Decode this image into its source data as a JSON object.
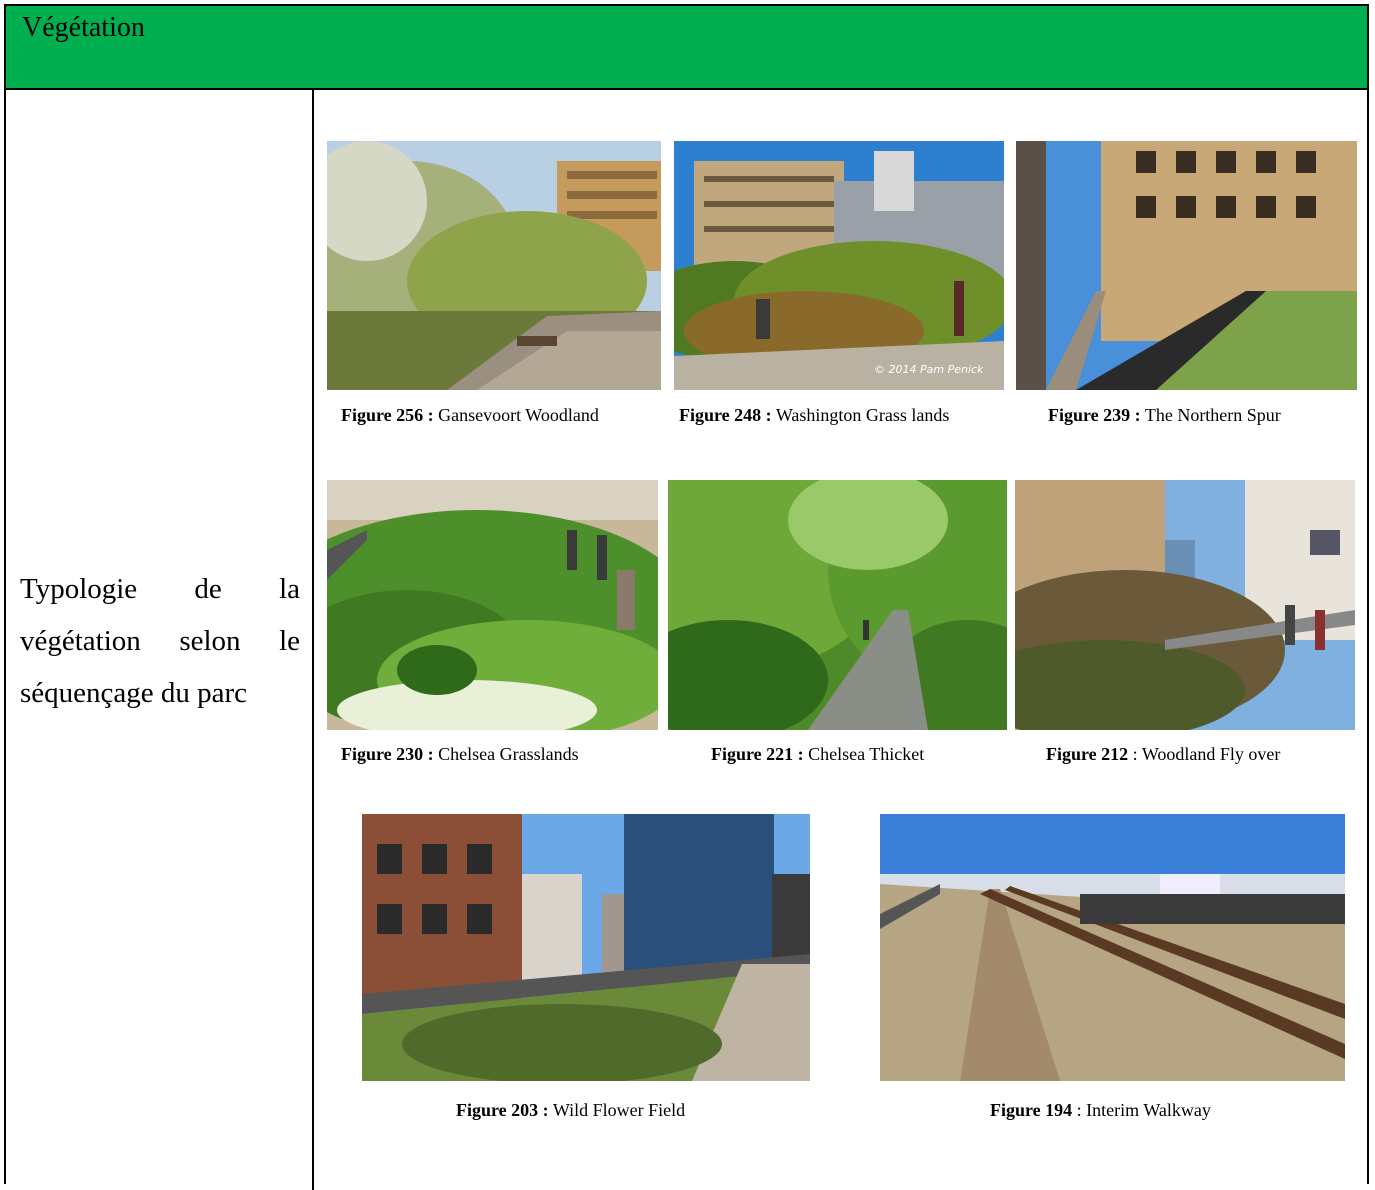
{
  "header": {
    "title": "Végétation"
  },
  "left_cell": {
    "text": "Typologie de la végétation selon le séquençage du parc"
  },
  "figures": [
    {
      "number": "Figure 256 :",
      "caption": " Gansevoort Woodland"
    },
    {
      "number": "Figure 248 :",
      "caption": " Washington Grass lands",
      "watermark": "© 2014 Pam Penick"
    },
    {
      "number": "Figure 239 :",
      "caption": " The Northern Spur"
    },
    {
      "number": "Figure 230 :",
      "caption": " Chelsea Grasslands"
    },
    {
      "number": "Figure 221 :",
      "caption": " Chelsea Thicket"
    },
    {
      "number": "Figure 212",
      "caption": " : Woodland Fly over"
    },
    {
      "number": "Figure 203 :",
      "caption": " Wild Flower Field"
    },
    {
      "number": "Figure 194",
      "caption": " : Interim Walkway"
    }
  ],
  "colors": {
    "header_bg": "#00b050"
  }
}
